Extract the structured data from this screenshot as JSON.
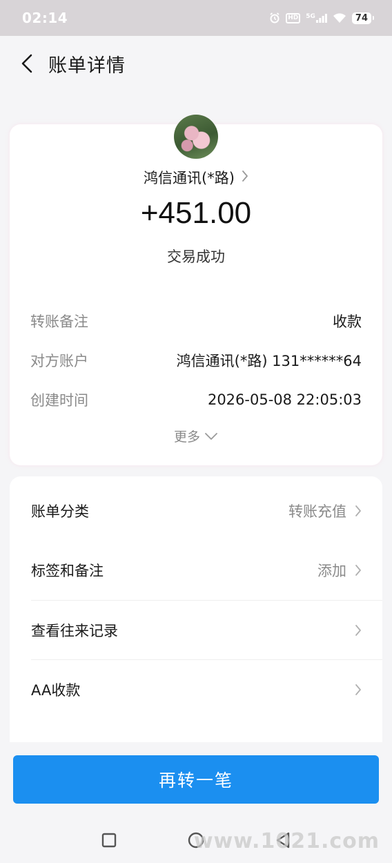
{
  "status_bar": {
    "time": "02:14",
    "icons": [
      "alarm-icon",
      "hd-icon",
      "5g-signal-icon",
      "wifi-icon"
    ],
    "hd_label": "HD",
    "network_label": "5G",
    "battery": "74"
  },
  "header": {
    "back_icon": "chevron-left-icon",
    "title": "账单详情"
  },
  "summary": {
    "merchant_name": "鸿信通讯(*路)",
    "amount": "+451.00",
    "status": "交易成功"
  },
  "details": [
    {
      "label": "转账备注",
      "value": "收款"
    },
    {
      "label": "对方账户",
      "value": "鸿信通讯(*路) 131******64"
    },
    {
      "label": "创建时间",
      "value": "2026-05-08 22:05:03"
    }
  ],
  "more_label": "更多",
  "list": [
    {
      "label": "账单分类",
      "value": "转账充值"
    },
    {
      "label": "标签和备注",
      "value": "添加"
    },
    {
      "label": "查看往来记录",
      "value": ""
    },
    {
      "label": "AA收款",
      "value": ""
    }
  ],
  "primary_button": "再转一笔",
  "system_nav": [
    "square-recents-icon",
    "circle-home-icon",
    "triangle-back-icon"
  ],
  "watermark": "www.1021.com",
  "colors": {
    "primary": "#1b8ff0",
    "background": "#f5f5f7",
    "status_bar": "#d8d4d7"
  }
}
